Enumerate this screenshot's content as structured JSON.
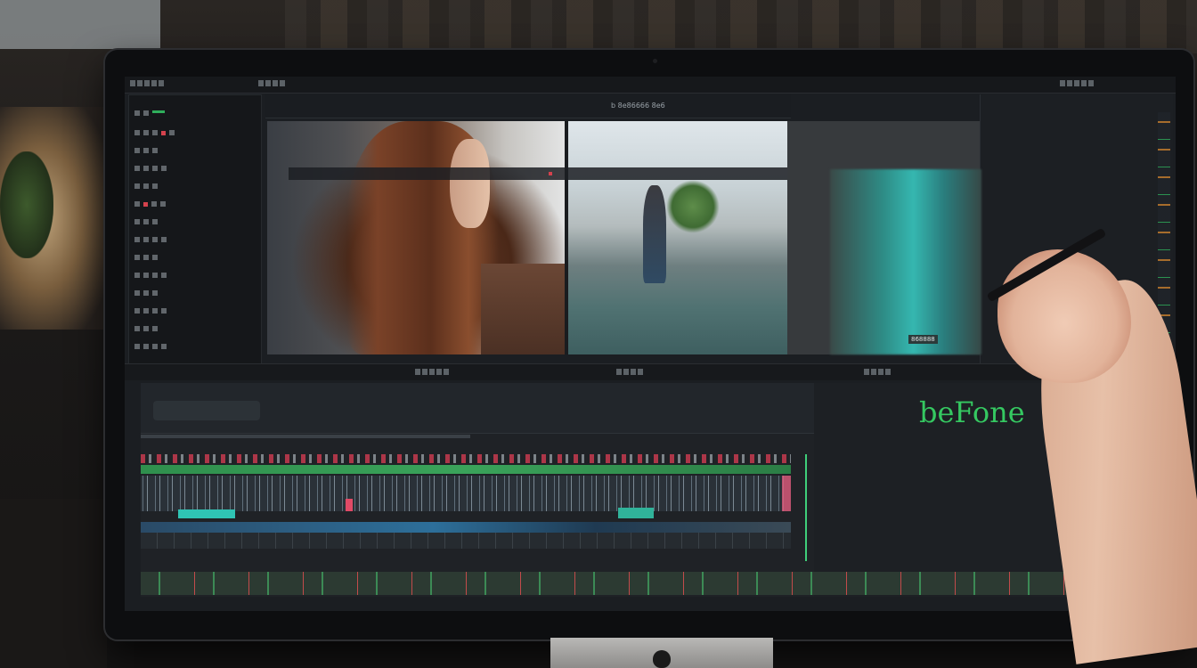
{
  "viewer": {
    "title": "b 8e86666 8e6"
  },
  "after_preview": {
    "label": "868888"
  },
  "overlay": {
    "before_text": "beFone"
  },
  "colors": {
    "accent_green": "#35c861",
    "clip_teal": "#2fc4b4",
    "clip_red": "#e04a66",
    "track_blue": "#2d6f9a",
    "screen_bg": "#1b1e22"
  },
  "icons": [
    "camera-dot",
    "apple-logo",
    "pen"
  ]
}
